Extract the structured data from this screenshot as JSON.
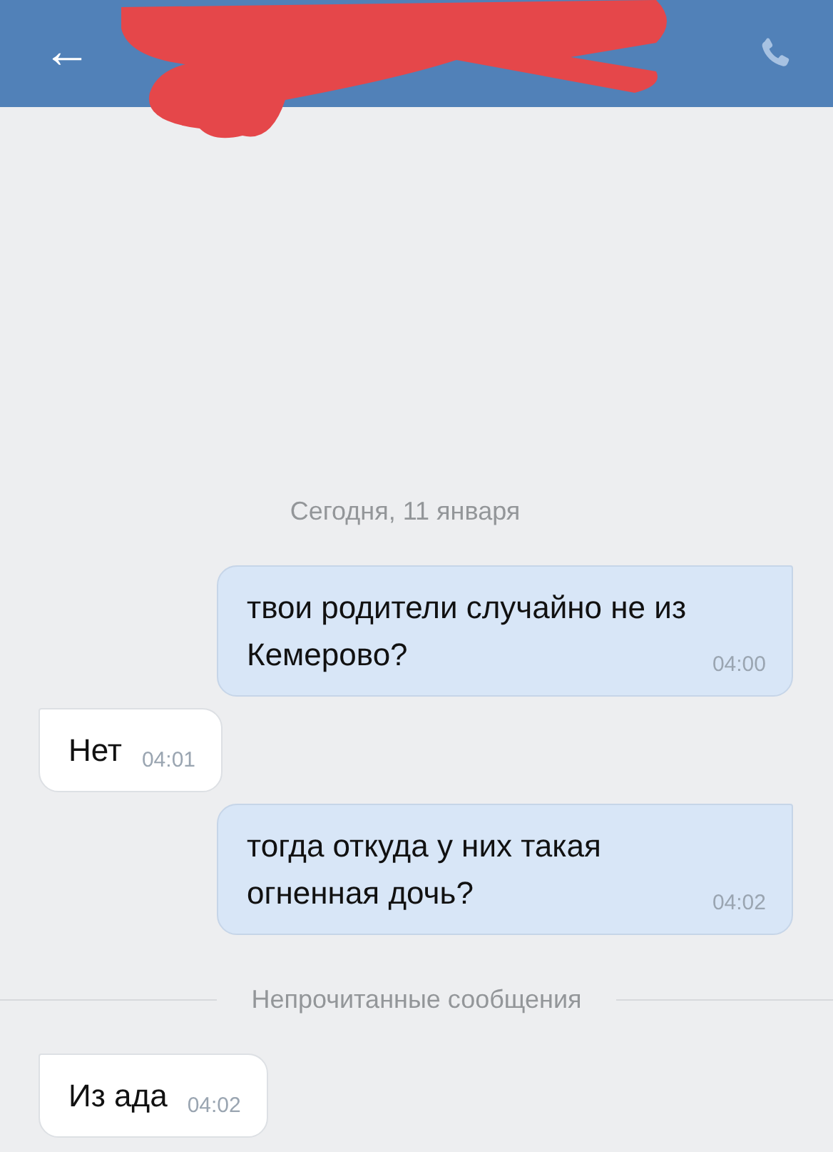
{
  "header": {
    "back": "←",
    "redacted": true
  },
  "items": [
    {
      "kind": "date",
      "text": "Сегодня, 11 января"
    },
    {
      "kind": "message",
      "outgoing": true,
      "text": "твои родители случайно не из Кемерово?",
      "time": "04:00"
    },
    {
      "kind": "message",
      "outgoing": false,
      "text": "Нет",
      "time": "04:01"
    },
    {
      "kind": "message",
      "outgoing": true,
      "text": "тогда откуда у них такая огненная дочь?",
      "time": "04:02"
    },
    {
      "kind": "divider",
      "text": "Непрочитанные сообщения"
    },
    {
      "kind": "message",
      "outgoing": false,
      "text": "Из ада",
      "time": "04:02"
    }
  ]
}
